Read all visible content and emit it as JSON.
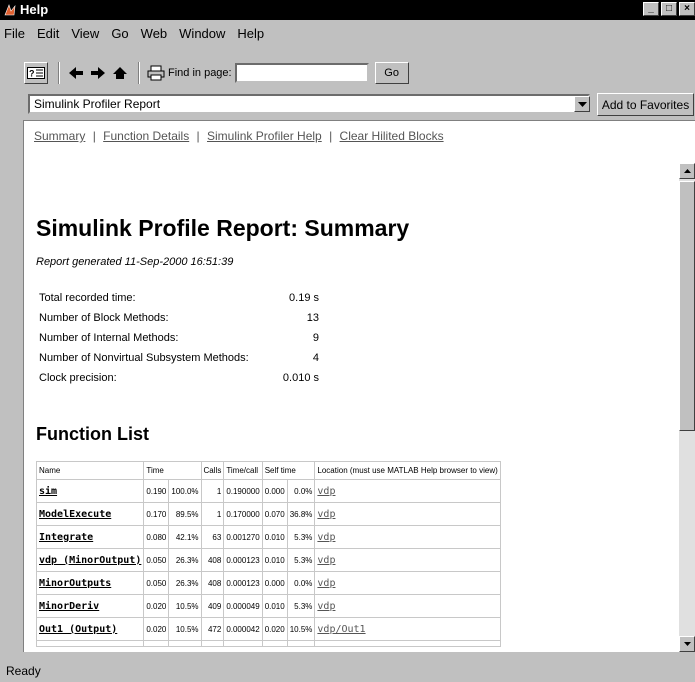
{
  "window": {
    "title": "Help"
  },
  "menu": [
    "File",
    "Edit",
    "View",
    "Go",
    "Web",
    "Window",
    "Help"
  ],
  "toolbar": {
    "icons": [
      "help-topics-icon",
      "back-arrow-icon",
      "forward-arrow-icon",
      "home-icon",
      "print-icon"
    ],
    "find_label": "Find in page:",
    "find_value": "",
    "go_label": "Go"
  },
  "address": {
    "selected": "Simulink Profiler Report",
    "favorites_label": "Add to Favorites"
  },
  "nav": {
    "summary": "Summary",
    "function_details": "Function Details",
    "profiler_help": "Simulink Profiler Help",
    "clear_blocks": "Clear Hilited Blocks",
    "separator": "|"
  },
  "report": {
    "title": "Simulink Profile Report: Summary",
    "generated": "Report generated 11-Sep-2000 16:51:39",
    "stats": [
      {
        "label": "Total recorded time:",
        "value": "0.19 s"
      },
      {
        "label": "Number of Block Methods:",
        "value": "13"
      },
      {
        "label": "Number of Internal Methods:",
        "value": "9"
      },
      {
        "label": "Number of Nonvirtual Subsystem Methods:",
        "value": "4"
      },
      {
        "label": "Clock precision:",
        "value": "0.010 s"
      }
    ],
    "function_list_title": "Function List"
  },
  "table": {
    "headers": [
      "Name",
      "Time",
      "Calls",
      "Time/call",
      "Self time",
      "Location (must use MATLAB Help browser to view)"
    ],
    "rows": [
      {
        "name": "sim",
        "time": "0.190",
        "pct": "100.0%",
        "calls": "1",
        "per_call": "0.190000",
        "self": "0.000",
        "self_pct": "0.0%",
        "loc": "vdp"
      },
      {
        "name": "ModelExecute",
        "time": "0.170",
        "pct": "89.5%",
        "calls": "1",
        "per_call": "0.170000",
        "self": "0.070",
        "self_pct": "36.8%",
        "loc": "vdp"
      },
      {
        "name": "Integrate",
        "time": "0.080",
        "pct": "42.1%",
        "calls": "63",
        "per_call": "0.001270",
        "self": "0.010",
        "self_pct": "5.3%",
        "loc": "vdp"
      },
      {
        "name": "vdp (MinorOutput)",
        "time": "0.050",
        "pct": "26.3%",
        "calls": "408",
        "per_call": "0.000123",
        "self": "0.010",
        "self_pct": "5.3%",
        "loc": "vdp"
      },
      {
        "name": "MinorOutputs",
        "time": "0.050",
        "pct": "26.3%",
        "calls": "408",
        "per_call": "0.000123",
        "self": "0.000",
        "self_pct": "0.0%",
        "loc": "vdp"
      },
      {
        "name": "MinorDeriv",
        "time": "0.020",
        "pct": "10.5%",
        "calls": "409",
        "per_call": "0.000049",
        "self": "0.010",
        "self_pct": "5.3%",
        "loc": "vdp"
      },
      {
        "name": "Out1 (Output)",
        "time": "0.020",
        "pct": "10.5%",
        "calls": "472",
        "per_call": "0.000042",
        "self": "0.020",
        "self_pct": "10.5%",
        "loc": "vdp/Out1"
      }
    ]
  },
  "status": "Ready"
}
